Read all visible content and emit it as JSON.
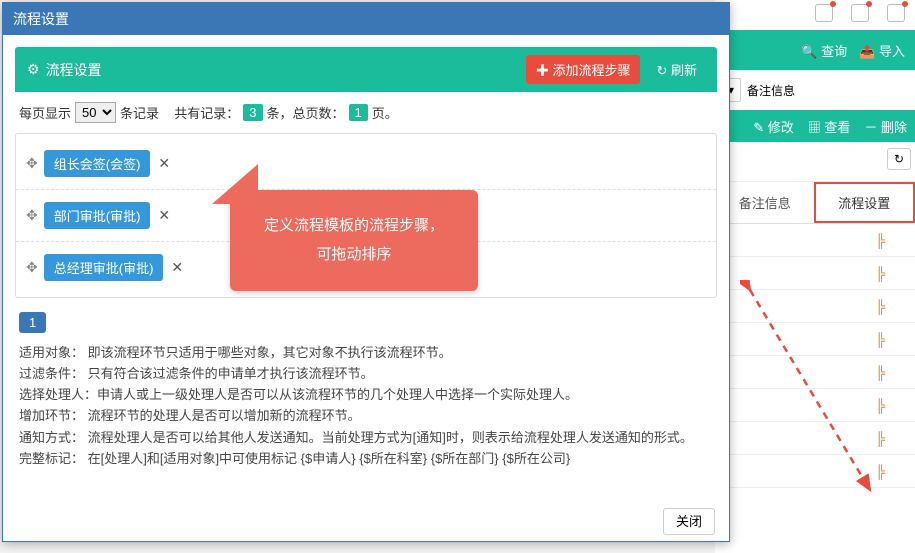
{
  "modal": {
    "title": "流程设置",
    "panel_title": "流程设置",
    "add_btn": "添加流程步骤",
    "refresh_btn": "刷新",
    "close_btn": "关闭"
  },
  "pager": {
    "prefix": "每页显示",
    "per_page_value": "50",
    "suffix1": "条记录",
    "total_label": "共有记录：",
    "total_count": "3",
    "total_suffix": "条，总页数：",
    "page_count": "1",
    "page_suffix": "页。"
  },
  "steps": [
    {
      "label": "组长会签(会签)"
    },
    {
      "label": "部门审批(审批)"
    },
    {
      "label": "总经理审批(审批)"
    }
  ],
  "page_num": "1",
  "help": {
    "l1": "适用对象： 即该流程环节只适用于哪些对象，其它对象不执行该流程环节。",
    "l2": "过滤条件： 只有符合该过滤条件的申请单才执行该流程环节。",
    "l3": "选择处理人：申请人或上一级处理人是否可以从该流程环节的几个处理人中选择一个实际处理人。",
    "l4": "增加环节： 流程环节的处理人是否可以增加新的流程环节。",
    "l5": "通知方式： 流程处理人是否可以给其他人发送通知。当前处理方式为[通知]时，则表示给流程处理人发送通知的形式。",
    "l6": "完整标记： 在[处理人]和[适用对象]中可使用标记 {$申请人} {$所在科室} {$所在部门} {$所在公司}"
  },
  "callout": {
    "line1": "定义流程模板的流程步骤，",
    "line2": "可拖动排序"
  },
  "back": {
    "query": "查询",
    "export": "导入",
    "remark_label": "备注信息",
    "edit": "修改",
    "view": "查看",
    "delete": "删除",
    "col_remark": "备注信息",
    "col_setting": "流程设置"
  }
}
